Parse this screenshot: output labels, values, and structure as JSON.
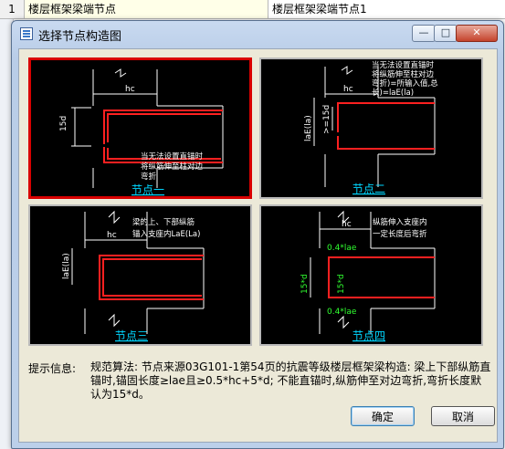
{
  "grid": {
    "row_index": "1",
    "row_name": "楼层框架梁端节点",
    "row_value": "楼层框架梁端节点1"
  },
  "dialog": {
    "title": "选择节点构造图",
    "icons": {
      "app": "dialog-icon",
      "minimize": "minimize-icon",
      "maximize": "maximize-icon",
      "close": "close-icon"
    }
  },
  "nodes": [
    {
      "caption": "节点一",
      "selected": true,
      "labels": {
        "hc": "hc",
        "dim": "15d",
        "note": [
          "当无法设置直锚时",
          "将纵筋伸至柱对边",
          "弯折"
        ]
      }
    },
    {
      "caption": "节点二",
      "selected": false,
      "labels": {
        "hc": "hc",
        "dim_left": "laE(la)",
        "dim_hook": ">=15d",
        "note": [
          "当无法设置直锚时",
          "将纵筋伸至柱对边",
          "弯折)=所输入值,总",
          "长)=laE(la)"
        ]
      }
    },
    {
      "caption": "节点三",
      "selected": false,
      "labels": {
        "hc": "hc",
        "dim_left": "laE(la)",
        "note": [
          "梁的上、下部纵筋",
          "锚入支座内LaE(La)"
        ]
      }
    },
    {
      "caption": "节点四",
      "selected": false,
      "labels": {
        "hc": "hc",
        "top": "0.4*lae",
        "bottom": "0.4*lae",
        "dim_a": "15*d",
        "dim_b": "15*d",
        "note": [
          "纵筋伸入支座内",
          "一定长度后弯折"
        ]
      }
    }
  ],
  "info": {
    "label": "提示信息:",
    "text": "规范算法: 节点来源03G101-1第54页的抗震等级楼层框架梁构造: 梁上下部纵筋直锚时,锚固长度≥lae且≥0.5*hc+5*d; 不能直锚时,纵筋伸至对边弯折,弯折长度默认为15*d。"
  },
  "buttons": {
    "ok": "确定",
    "cancel": "取消"
  },
  "colors": {
    "rebar": "#ff2020",
    "selected_border": "#d80000",
    "caption": "#00d6ff",
    "dimension_green": "#30ff30"
  }
}
